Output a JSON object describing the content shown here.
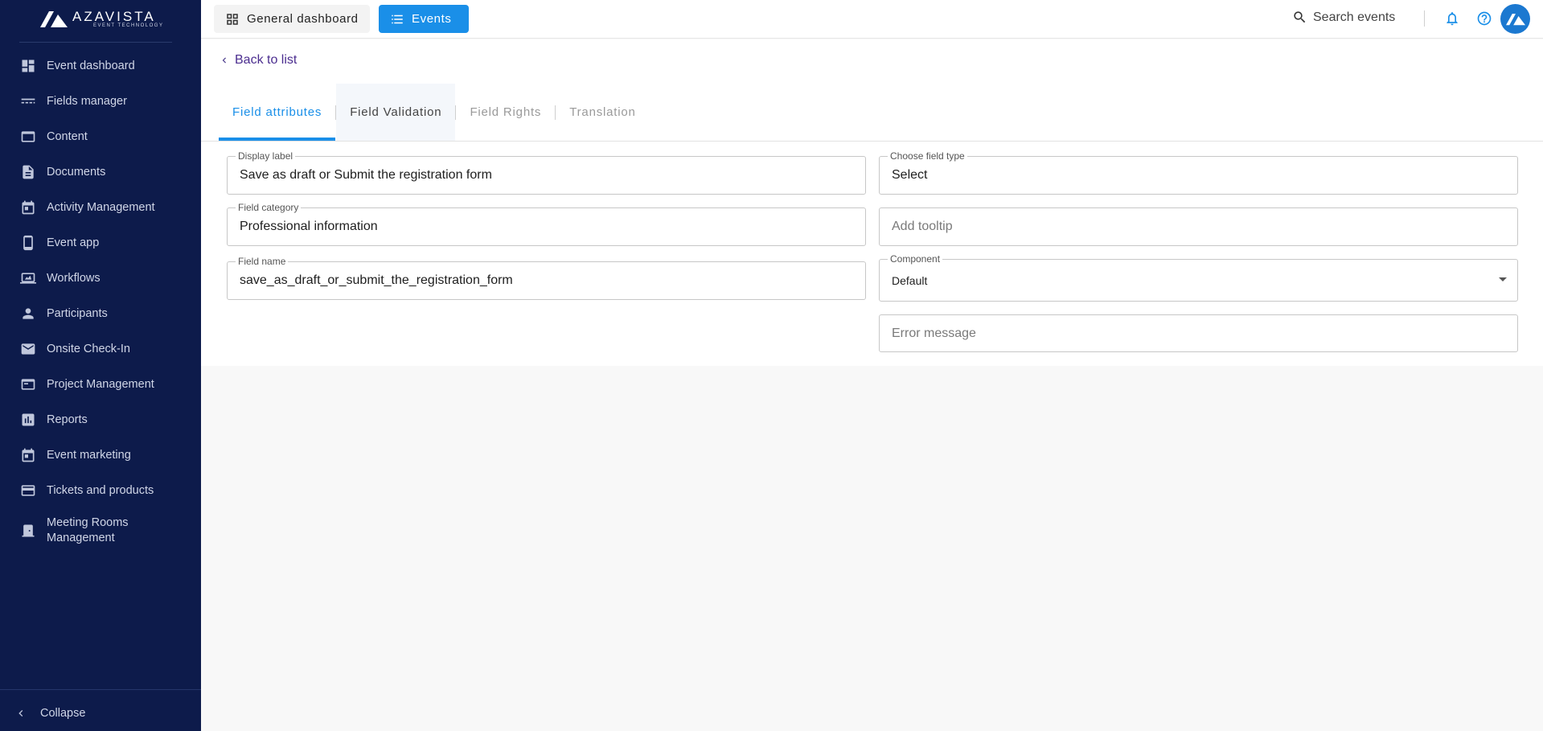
{
  "brand": {
    "name": "AZAVISTA",
    "tagline": "EVENT TECHNOLOGY"
  },
  "sidebar": {
    "items": [
      {
        "label": "Event dashboard",
        "icon": "dashboard-icon"
      },
      {
        "label": "Fields manager",
        "icon": "fields-icon"
      },
      {
        "label": "Content",
        "icon": "content-icon"
      },
      {
        "label": "Documents",
        "icon": "document-icon"
      },
      {
        "label": "Activity Management",
        "icon": "calendar-icon"
      },
      {
        "label": "Event app",
        "icon": "phone-icon"
      },
      {
        "label": "Workflows",
        "icon": "workflow-icon"
      },
      {
        "label": "Participants",
        "icon": "person-icon"
      },
      {
        "label": "Onsite Check-In",
        "icon": "mail-icon"
      },
      {
        "label": "Project Management",
        "icon": "browser-icon"
      },
      {
        "label": "Reports",
        "icon": "chart-icon"
      },
      {
        "label": "Event marketing",
        "icon": "calendar-icon"
      },
      {
        "label": "Tickets and products",
        "icon": "card-icon"
      },
      {
        "label": "Meeting Rooms Management",
        "icon": "door-icon"
      }
    ],
    "collapse_label": "Collapse"
  },
  "topbar": {
    "general_dashboard_label": "General dashboard",
    "events_label": "Events",
    "search_label": "Search events"
  },
  "content": {
    "back_label": "Back to list",
    "tabs": [
      {
        "label": "Field attributes",
        "state": "active"
      },
      {
        "label": "Field Validation",
        "state": "hover"
      },
      {
        "label": "Field Rights",
        "state": "muted"
      },
      {
        "label": "Translation",
        "state": "muted"
      }
    ],
    "fields": {
      "display_label": {
        "legend": "Display label",
        "value": "Save as draft or Submit the registration form"
      },
      "field_type": {
        "legend": "Choose field type",
        "value": "Select"
      },
      "field_category": {
        "legend": "Field category",
        "value": "Professional information"
      },
      "tooltip": {
        "placeholder": "Add tooltip"
      },
      "field_name": {
        "legend": "Field name",
        "value": "save_as_draft_or_submit_the_registration_form"
      },
      "component": {
        "legend": "Component",
        "value": "Default"
      },
      "error_message": {
        "placeholder": "Error message"
      }
    }
  },
  "colors": {
    "sidebar_bg": "#0d1b4b",
    "accent": "#1a8fe8",
    "back_link": "#4b2d8f"
  }
}
